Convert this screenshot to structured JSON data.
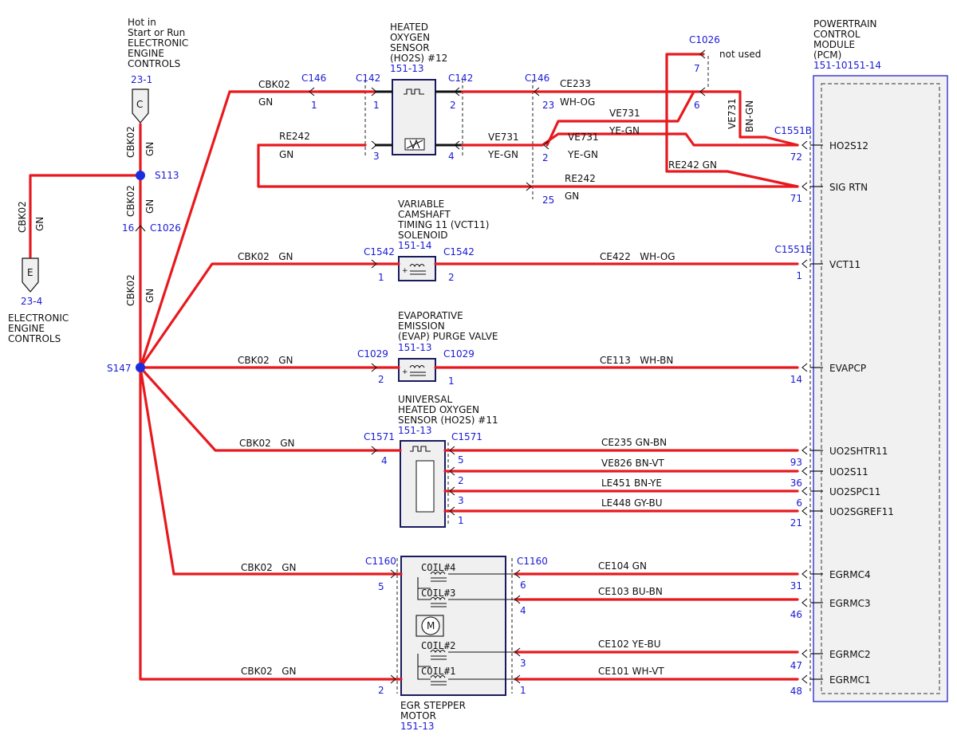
{
  "left": {
    "hot_note": [
      "Hot in",
      "Start or Run",
      "ELECTRONIC",
      "ENGINE",
      "CONTROLS"
    ],
    "ref_top": "23-1",
    "connector_c": "C",
    "connector_e": "E",
    "ref_bottom": "23-4",
    "bottom_note": [
      "ELECTRONIC",
      "ENGINE",
      "CONTROLS"
    ],
    "wire_code": "CBK02",
    "wire_color": "GN",
    "splice_s113": "S113",
    "splice_s147": "S147",
    "conn_c1026": "C1026",
    "pin_16": "16"
  },
  "pcm": {
    "title": [
      "POWERTRAIN",
      "CONTROL",
      "MODULE",
      "(PCM)"
    ],
    "ref": "151-10151-14",
    "pins": [
      {
        "label": "HO2S12",
        "pin": "72",
        "conn": "C1551B"
      },
      {
        "label": "SIG RTN",
        "pin": "71",
        "conn": ""
      },
      {
        "label": "VCT11",
        "pin": "1",
        "conn": "C1551E"
      },
      {
        "label": "EVAPCP",
        "pin": "14",
        "conn": ""
      },
      {
        "label": "UO2SHTR11",
        "pin": "93",
        "conn": ""
      },
      {
        "label": "UO2S11",
        "pin": "36",
        "conn": ""
      },
      {
        "label": "UO2SPC11",
        "pin": "6",
        "conn": ""
      },
      {
        "label": "UO2SGREF11",
        "pin": "21",
        "conn": ""
      },
      {
        "label": "EGRMC4",
        "pin": "31",
        "conn": ""
      },
      {
        "label": "EGRMC3",
        "pin": "46",
        "conn": ""
      },
      {
        "label": "EGRMC2",
        "pin": "47",
        "conn": ""
      },
      {
        "label": "EGRMC1",
        "pin": "48",
        "conn": ""
      }
    ]
  },
  "ho2s12": {
    "title": [
      "HEATED",
      "OXYGEN",
      "SENSOR",
      "(HO2S) #12"
    ],
    "ref": "151-13",
    "c146": "C146",
    "c142": "C142",
    "pin_1": "1",
    "pin_2": "2",
    "pin_3": "3",
    "pin_4": "4",
    "pin_23": "23",
    "pin_25": "25",
    "pin_2b": "2",
    "c1026": "C1026",
    "pin_7": "7",
    "pin_6": "6",
    "not_used": "not used",
    "wires": {
      "cbk02": "CBK02",
      "gn": "GN",
      "re242": "RE242",
      "ce233": "CE233",
      "wh_og": "WH-OG",
      "ve731": "VE731",
      "ye_gn": "YE-GN",
      "bn_gn": "BN-GN",
      "re242_gn": "RE242  GN"
    }
  },
  "vct11": {
    "title": [
      "VARIABLE",
      "CAMSHAFT",
      "TIMING 11 (VCT11)",
      "SOLENOID"
    ],
    "ref": "151-14",
    "conn": "C1542",
    "pin_a": "1",
    "pin_b": "2",
    "wire_in": "CBK02   GN",
    "wire_out": "CE422   WH-OG"
  },
  "evap": {
    "title": [
      "EVAPORATIVE",
      "EMISSION",
      "(EVAP) PURGE VALVE"
    ],
    "ref": "151-13",
    "conn": "C1029",
    "pin_a": "2",
    "pin_b": "1",
    "wire_in": "CBK02   GN",
    "wire_out": "CE113   WH-BN"
  },
  "uho2s11": {
    "title": [
      "UNIVERSAL",
      "HEATED OXYGEN",
      "SENSOR (HO2S) #11"
    ],
    "ref": "151-13",
    "conn": "C1571",
    "pin_in": "4",
    "wire_in": "CBK02   GN",
    "outs": [
      {
        "pin": "5",
        "wire": "CE235   GN-BN"
      },
      {
        "pin": "2",
        "wire": "VE826   BN-VT"
      },
      {
        "pin": "3",
        "wire": "LE451   BN-YE"
      },
      {
        "pin": "1",
        "wire": "LE448   GY-BU"
      }
    ]
  },
  "egr": {
    "title": [
      "EGR STEPPER",
      "MOTOR"
    ],
    "ref": "151-13",
    "conn": "C1160",
    "pin_in_a": "5",
    "pin_in_b": "2",
    "wire_in": "CBK02   GN",
    "coils": [
      "COIL#4",
      "COIL#3",
      "COIL#2",
      "COIL#1"
    ],
    "motor": "M",
    "outs": [
      {
        "pin": "6",
        "wire": "CE104   GN"
      },
      {
        "pin": "4",
        "wire": "CE103   BU-BN"
      },
      {
        "pin": "3",
        "wire": "CE102   YE-BU"
      },
      {
        "pin": "1",
        "wire": "CE101   WH-VT"
      }
    ]
  },
  "colors": {
    "wire": "#e8191e",
    "ref": "#1a1ad6",
    "component": "#1a1a5e",
    "pcm_border": "#3333cc"
  }
}
